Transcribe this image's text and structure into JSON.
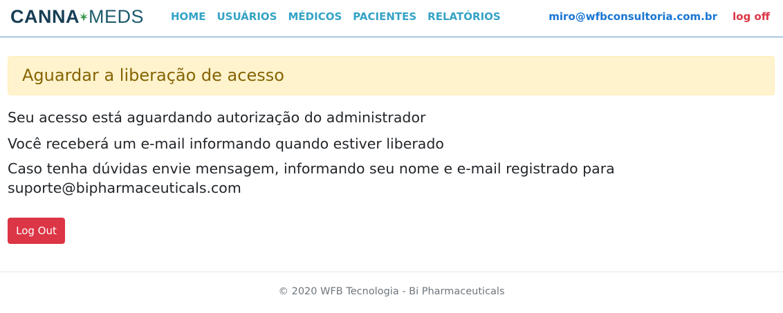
{
  "header": {
    "brand_part1": "CANNA",
    "brand_part2": "MEDS",
    "nav": [
      {
        "label": "HOME"
      },
      {
        "label": "USUÁRIOS"
      },
      {
        "label": "MÉDICOS"
      },
      {
        "label": "PACIENTES"
      },
      {
        "label": "RELATÓRIOS"
      }
    ],
    "user_email": "miro@wfbconsultoria.com.br",
    "logoff_label": "log off"
  },
  "alert": {
    "title": "Aguardar a liberação de acesso"
  },
  "messages": {
    "line1": "Seu acesso está aguardando autorização do administrador",
    "line2": "Você receberá um e-mail informando quando estiver liberado",
    "line3": "Caso tenha dúvidas envie mensagem, informando seu nome e e-mail registrado para suporte@bipharmaceuticals.com"
  },
  "logout_button": "Log Out",
  "footer": {
    "text": "© 2020 WFB Tecnologia - Bi Pharmaceuticals"
  },
  "colors": {
    "nav": "#34a3c6",
    "email": "#1976d2",
    "danger": "#dc3545",
    "alert_bg": "#fff3cd",
    "alert_text": "#856404",
    "brand_dark": "#173e54"
  },
  "icons": {
    "brand_leaf": "cannabis-leaf-icon"
  }
}
